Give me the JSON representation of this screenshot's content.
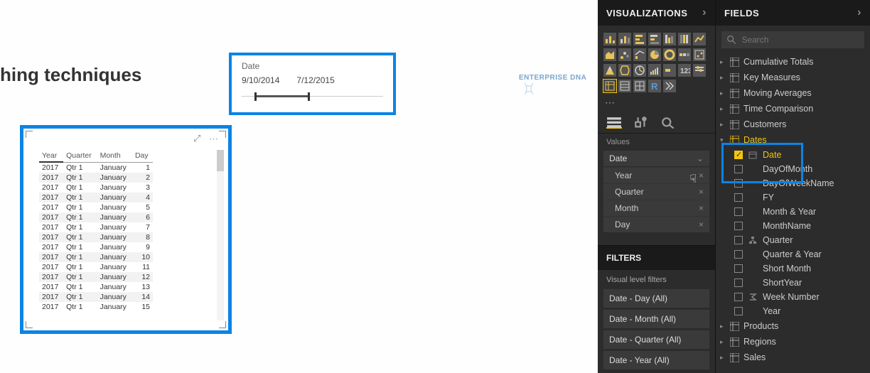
{
  "report": {
    "title": "hing techniques",
    "logo": "ENTERPRISE DNA"
  },
  "slicer": {
    "label": "Date",
    "start": "9/10/2014",
    "end": "7/12/2015"
  },
  "table": {
    "headers": [
      "Year",
      "Quarter",
      "Month",
      "Day"
    ],
    "rows": [
      [
        "2017",
        "Qtr 1",
        "January",
        "1"
      ],
      [
        "2017",
        "Qtr 1",
        "January",
        "2"
      ],
      [
        "2017",
        "Qtr 1",
        "January",
        "3"
      ],
      [
        "2017",
        "Qtr 1",
        "January",
        "4"
      ],
      [
        "2017",
        "Qtr 1",
        "January",
        "5"
      ],
      [
        "2017",
        "Qtr 1",
        "January",
        "6"
      ],
      [
        "2017",
        "Qtr 1",
        "January",
        "7"
      ],
      [
        "2017",
        "Qtr 1",
        "January",
        "8"
      ],
      [
        "2017",
        "Qtr 1",
        "January",
        "9"
      ],
      [
        "2017",
        "Qtr 1",
        "January",
        "10"
      ],
      [
        "2017",
        "Qtr 1",
        "January",
        "11"
      ],
      [
        "2017",
        "Qtr 1",
        "January",
        "12"
      ],
      [
        "2017",
        "Qtr 1",
        "January",
        "13"
      ],
      [
        "2017",
        "Qtr 1",
        "January",
        "14"
      ],
      [
        "2017",
        "Qtr 1",
        "January",
        "15"
      ]
    ]
  },
  "viz_pane": {
    "title": "VISUALIZATIONS",
    "values_label": "Values",
    "well_head": "Date",
    "well_items": [
      "Year",
      "Quarter",
      "Month",
      "Day"
    ],
    "filters_title": "FILTERS",
    "filters_sub": "Visual level filters",
    "filters": [
      "Date - Day (All)",
      "Date - Month (All)",
      "Date - Quarter (All)",
      "Date - Year (All)"
    ]
  },
  "fields_pane": {
    "title": "FIELDS",
    "search_placeholder": "Search",
    "tables_top": [
      "Cumulative Totals",
      "Key Measures",
      "Moving Averages",
      "Time Comparison",
      "Customers"
    ],
    "expanded_table": "Dates",
    "columns": [
      {
        "name": "Date",
        "checked": true,
        "icon": "calendar"
      },
      {
        "name": "DayOfMonth",
        "checked": false,
        "icon": "none",
        "clipped": true
      },
      {
        "name": "DayOfWeekName",
        "checked": false,
        "icon": "none"
      },
      {
        "name": "FY",
        "checked": false,
        "icon": "none"
      },
      {
        "name": "Month & Year",
        "checked": false,
        "icon": "none"
      },
      {
        "name": "MonthName",
        "checked": false,
        "icon": "none"
      },
      {
        "name": "Quarter",
        "checked": false,
        "icon": "hierarchy"
      },
      {
        "name": "Quarter & Year",
        "checked": false,
        "icon": "none"
      },
      {
        "name": "Short Month",
        "checked": false,
        "icon": "none"
      },
      {
        "name": "ShortYear",
        "checked": false,
        "icon": "none"
      },
      {
        "name": "Week Number",
        "checked": false,
        "icon": "sigma"
      },
      {
        "name": "Year",
        "checked": false,
        "icon": "none"
      }
    ],
    "tables_bottom": [
      "Products",
      "Regions",
      "Sales"
    ]
  }
}
